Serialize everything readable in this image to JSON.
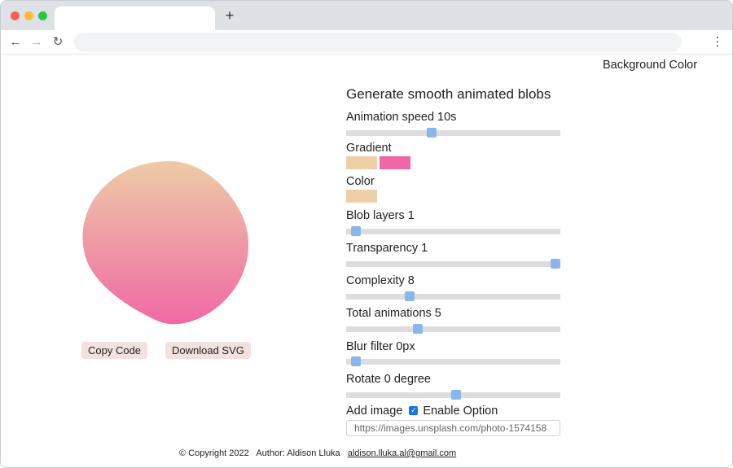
{
  "browser": {
    "new_tab_symbol": "+",
    "back_symbol": "←",
    "forward_symbol": "→",
    "reload_symbol": "↻",
    "menu_symbol": "⋮",
    "icons": [
      "back-arrow-icon",
      "forward-arrow-icon",
      "reload-icon",
      "kebab-menu-icon"
    ],
    "traffic_lights": [
      "#fe5f57",
      "#febc2e",
      "#28c840"
    ]
  },
  "page": {
    "background_color_label": "Background Color"
  },
  "blob": {
    "gradient_top": "#eecba6",
    "gradient_bottom": "#f069a4"
  },
  "actions": {
    "copy_code": "Copy Code",
    "download_svg": "Download SVG"
  },
  "panel": {
    "title": "Generate smooth animated blobs",
    "animation_speed": {
      "label": "Animation speed 10s",
      "level": 0.38
    },
    "gradient": {
      "label": "Gradient",
      "colors": [
        "#eed0a8",
        "#f066a6"
      ]
    },
    "color": {
      "label": "Color",
      "value": "#eed0a8"
    },
    "blob_layers": {
      "label": "Blob layers 1",
      "level": 0.0
    },
    "transparency": {
      "label": "Transparency 1",
      "level": 1.0
    },
    "complexity": {
      "label": "Complexity 8",
      "level": 0.27
    },
    "total_animations": {
      "label": "Total animations 5",
      "level": 0.31
    },
    "blur_filter": {
      "label": "Blur filter 0px",
      "level": 0.0
    },
    "rotate": {
      "label": "Rotate 0 degree",
      "level": 0.5
    },
    "add_image": {
      "label": "Add image",
      "checkbox_label": "Enable Option",
      "checked": true,
      "url_value": "https://images.unsplash.com/photo-1574158"
    }
  },
  "footer": {
    "copyright": "© Copyright 2022",
    "author": "Author: Aldison Lluka",
    "email": "aldison.lluka.al@gmail.com"
  }
}
